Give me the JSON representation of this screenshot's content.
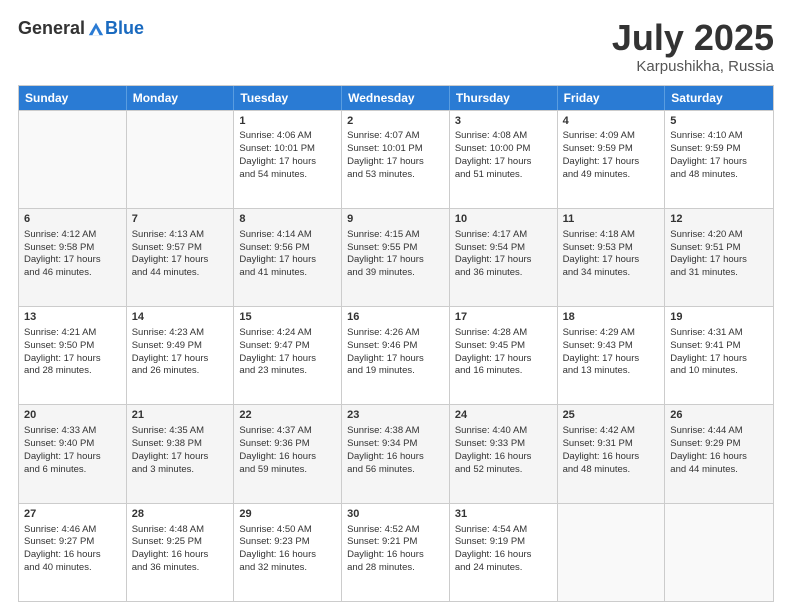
{
  "header": {
    "logo_general": "General",
    "logo_blue": "Blue",
    "title": "July 2025",
    "location": "Karpushikha, Russia"
  },
  "weekdays": [
    "Sunday",
    "Monday",
    "Tuesday",
    "Wednesday",
    "Thursday",
    "Friday",
    "Saturday"
  ],
  "rows": [
    [
      {
        "day": "",
        "lines": [],
        "empty": true
      },
      {
        "day": "",
        "lines": [],
        "empty": true
      },
      {
        "day": "1",
        "lines": [
          "Sunrise: 4:06 AM",
          "Sunset: 10:01 PM",
          "Daylight: 17 hours",
          "and 54 minutes."
        ]
      },
      {
        "day": "2",
        "lines": [
          "Sunrise: 4:07 AM",
          "Sunset: 10:01 PM",
          "Daylight: 17 hours",
          "and 53 minutes."
        ]
      },
      {
        "day": "3",
        "lines": [
          "Sunrise: 4:08 AM",
          "Sunset: 10:00 PM",
          "Daylight: 17 hours",
          "and 51 minutes."
        ]
      },
      {
        "day": "4",
        "lines": [
          "Sunrise: 4:09 AM",
          "Sunset: 9:59 PM",
          "Daylight: 17 hours",
          "and 49 minutes."
        ]
      },
      {
        "day": "5",
        "lines": [
          "Sunrise: 4:10 AM",
          "Sunset: 9:59 PM",
          "Daylight: 17 hours",
          "and 48 minutes."
        ]
      }
    ],
    [
      {
        "day": "6",
        "lines": [
          "Sunrise: 4:12 AM",
          "Sunset: 9:58 PM",
          "Daylight: 17 hours",
          "and 46 minutes."
        ],
        "shaded": true
      },
      {
        "day": "7",
        "lines": [
          "Sunrise: 4:13 AM",
          "Sunset: 9:57 PM",
          "Daylight: 17 hours",
          "and 44 minutes."
        ],
        "shaded": true
      },
      {
        "day": "8",
        "lines": [
          "Sunrise: 4:14 AM",
          "Sunset: 9:56 PM",
          "Daylight: 17 hours",
          "and 41 minutes."
        ],
        "shaded": true
      },
      {
        "day": "9",
        "lines": [
          "Sunrise: 4:15 AM",
          "Sunset: 9:55 PM",
          "Daylight: 17 hours",
          "and 39 minutes."
        ],
        "shaded": true
      },
      {
        "day": "10",
        "lines": [
          "Sunrise: 4:17 AM",
          "Sunset: 9:54 PM",
          "Daylight: 17 hours",
          "and 36 minutes."
        ],
        "shaded": true
      },
      {
        "day": "11",
        "lines": [
          "Sunrise: 4:18 AM",
          "Sunset: 9:53 PM",
          "Daylight: 17 hours",
          "and 34 minutes."
        ],
        "shaded": true
      },
      {
        "day": "12",
        "lines": [
          "Sunrise: 4:20 AM",
          "Sunset: 9:51 PM",
          "Daylight: 17 hours",
          "and 31 minutes."
        ],
        "shaded": true
      }
    ],
    [
      {
        "day": "13",
        "lines": [
          "Sunrise: 4:21 AM",
          "Sunset: 9:50 PM",
          "Daylight: 17 hours",
          "and 28 minutes."
        ]
      },
      {
        "day": "14",
        "lines": [
          "Sunrise: 4:23 AM",
          "Sunset: 9:49 PM",
          "Daylight: 17 hours",
          "and 26 minutes."
        ]
      },
      {
        "day": "15",
        "lines": [
          "Sunrise: 4:24 AM",
          "Sunset: 9:47 PM",
          "Daylight: 17 hours",
          "and 23 minutes."
        ]
      },
      {
        "day": "16",
        "lines": [
          "Sunrise: 4:26 AM",
          "Sunset: 9:46 PM",
          "Daylight: 17 hours",
          "and 19 minutes."
        ]
      },
      {
        "day": "17",
        "lines": [
          "Sunrise: 4:28 AM",
          "Sunset: 9:45 PM",
          "Daylight: 17 hours",
          "and 16 minutes."
        ]
      },
      {
        "day": "18",
        "lines": [
          "Sunrise: 4:29 AM",
          "Sunset: 9:43 PM",
          "Daylight: 17 hours",
          "and 13 minutes."
        ]
      },
      {
        "day": "19",
        "lines": [
          "Sunrise: 4:31 AM",
          "Sunset: 9:41 PM",
          "Daylight: 17 hours",
          "and 10 minutes."
        ]
      }
    ],
    [
      {
        "day": "20",
        "lines": [
          "Sunrise: 4:33 AM",
          "Sunset: 9:40 PM",
          "Daylight: 17 hours",
          "and 6 minutes."
        ],
        "shaded": true
      },
      {
        "day": "21",
        "lines": [
          "Sunrise: 4:35 AM",
          "Sunset: 9:38 PM",
          "Daylight: 17 hours",
          "and 3 minutes."
        ],
        "shaded": true
      },
      {
        "day": "22",
        "lines": [
          "Sunrise: 4:37 AM",
          "Sunset: 9:36 PM",
          "Daylight: 16 hours",
          "and 59 minutes."
        ],
        "shaded": true
      },
      {
        "day": "23",
        "lines": [
          "Sunrise: 4:38 AM",
          "Sunset: 9:34 PM",
          "Daylight: 16 hours",
          "and 56 minutes."
        ],
        "shaded": true
      },
      {
        "day": "24",
        "lines": [
          "Sunrise: 4:40 AM",
          "Sunset: 9:33 PM",
          "Daylight: 16 hours",
          "and 52 minutes."
        ],
        "shaded": true
      },
      {
        "day": "25",
        "lines": [
          "Sunrise: 4:42 AM",
          "Sunset: 9:31 PM",
          "Daylight: 16 hours",
          "and 48 minutes."
        ],
        "shaded": true
      },
      {
        "day": "26",
        "lines": [
          "Sunrise: 4:44 AM",
          "Sunset: 9:29 PM",
          "Daylight: 16 hours",
          "and 44 minutes."
        ],
        "shaded": true
      }
    ],
    [
      {
        "day": "27",
        "lines": [
          "Sunrise: 4:46 AM",
          "Sunset: 9:27 PM",
          "Daylight: 16 hours",
          "and 40 minutes."
        ]
      },
      {
        "day": "28",
        "lines": [
          "Sunrise: 4:48 AM",
          "Sunset: 9:25 PM",
          "Daylight: 16 hours",
          "and 36 minutes."
        ]
      },
      {
        "day": "29",
        "lines": [
          "Sunrise: 4:50 AM",
          "Sunset: 9:23 PM",
          "Daylight: 16 hours",
          "and 32 minutes."
        ]
      },
      {
        "day": "30",
        "lines": [
          "Sunrise: 4:52 AM",
          "Sunset: 9:21 PM",
          "Daylight: 16 hours",
          "and 28 minutes."
        ]
      },
      {
        "day": "31",
        "lines": [
          "Sunrise: 4:54 AM",
          "Sunset: 9:19 PM",
          "Daylight: 16 hours",
          "and 24 minutes."
        ]
      },
      {
        "day": "",
        "lines": [],
        "empty": true
      },
      {
        "day": "",
        "lines": [],
        "empty": true
      }
    ]
  ]
}
